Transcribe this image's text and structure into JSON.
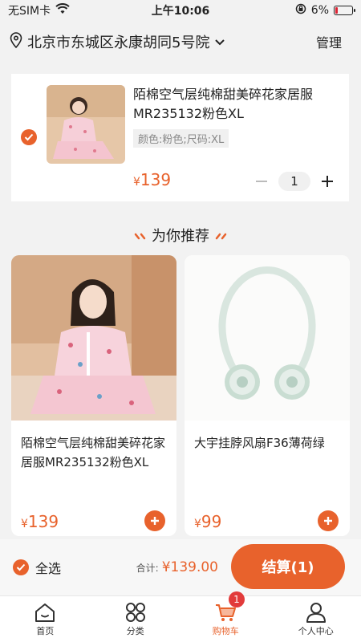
{
  "status_bar": {
    "carrier": "无SIM卡",
    "time": "上午10:06",
    "battery": "6%"
  },
  "header": {
    "address": "北京市东城区永康胡同5号院",
    "manage_label": "管理"
  },
  "cart": {
    "items": [
      {
        "title": "陌棉空气层纯棉甜美碎花家居服MR235132粉色XL",
        "spec": "颜色:粉色;尺码:XL",
        "currency": "¥",
        "price": "139",
        "quantity": "1",
        "selected": true
      }
    ]
  },
  "recommend": {
    "title": "为你推荐",
    "items": [
      {
        "name": "陌棉空气层纯棉甜美碎花家居服MR235132粉色XL",
        "currency": "¥",
        "price": "139"
      },
      {
        "name": "大宇挂脖风扇F36薄荷绿",
        "currency": "¥",
        "price": "99"
      }
    ]
  },
  "checkout": {
    "select_all_label": "全选",
    "total_label": "合计:",
    "total_value": "¥139.00",
    "button_label": "结算(1)"
  },
  "tabbar": {
    "tabs": [
      {
        "label": "首页",
        "icon": "home-icon"
      },
      {
        "label": "分类",
        "icon": "category-icon"
      },
      {
        "label": "购物车",
        "icon": "cart-icon",
        "badge": "1"
      },
      {
        "label": "个人中心",
        "icon": "user-icon"
      }
    ]
  },
  "colors": {
    "accent": "#e8622c",
    "badge": "#e23b3b",
    "background": "#f2f2f2"
  }
}
